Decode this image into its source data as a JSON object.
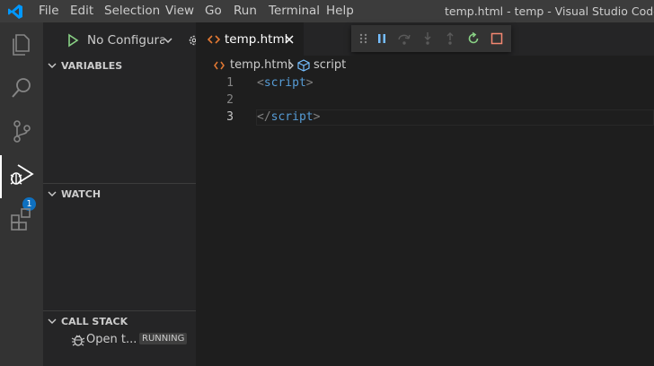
{
  "titlebar": {
    "menu": [
      "File",
      "Edit",
      "Selection",
      "View",
      "Go",
      "Run",
      "Terminal",
      "Help"
    ],
    "window_title": "temp.html - temp - Visual Studio Code"
  },
  "activitybar": {
    "items": [
      "explorer-icon",
      "search-icon",
      "source-control-icon",
      "run-debug-icon",
      "extensions-icon"
    ],
    "debug_badge": "1"
  },
  "sidebar": {
    "config_select": "No Configurati",
    "sections": {
      "variables": "VARIABLES",
      "watch": "WATCH",
      "callstack": "CALL STACK"
    },
    "callstack_item": {
      "label": "Open t...",
      "status": "RUNNING"
    }
  },
  "editor": {
    "tab_label": "temp.html",
    "breadcrumb": {
      "file": "temp.html",
      "symbol": "script"
    },
    "lines": [
      {
        "num": "1",
        "open": "<",
        "name": "script",
        "close": ">"
      },
      {
        "num": "2"
      },
      {
        "num": "3",
        "open": "</",
        "name": "script",
        "close": ">"
      }
    ]
  },
  "debug_toolbar": [
    "drag-handle-icon",
    "pause-icon",
    "step-over-icon",
    "step-into-icon",
    "step-out-icon",
    "restart-icon",
    "stop-icon"
  ],
  "colors": {
    "accent": "#0e70c0",
    "play": "#89d185",
    "restart": "#89d185",
    "stop": "#f48771",
    "tag": "#569cd6",
    "html_icon": "#e37933"
  }
}
